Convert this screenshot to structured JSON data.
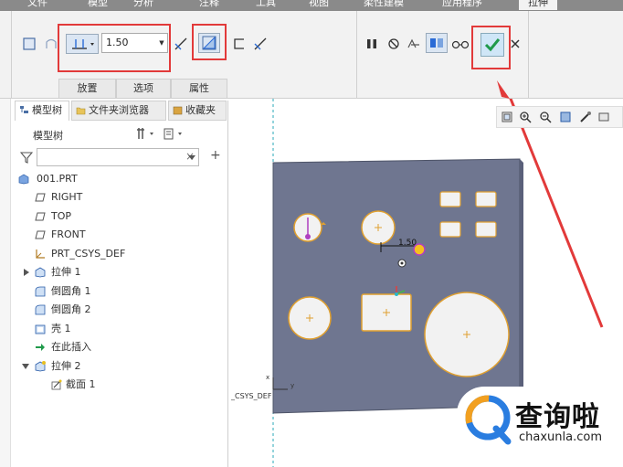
{
  "menu": {
    "tabs": [
      "文件",
      "模型",
      "分析",
      "注释",
      "工具",
      "视图",
      "柔性建模",
      "应用程序",
      "拉伸"
    ],
    "active_tab": "拉伸"
  },
  "ribbon": {
    "depth_value": "1.50",
    "subtabs": [
      "放置",
      "选项",
      "属性"
    ]
  },
  "panel": {
    "tabs": [
      "模型树",
      "文件夹浏览器",
      "收藏夹"
    ],
    "tree_title": "模型树",
    "filter_clear": "×",
    "filter_add": "+",
    "items": [
      {
        "label": "001.PRT",
        "icon": "part-icon"
      },
      {
        "label": "RIGHT",
        "icon": "datum-plane-icon"
      },
      {
        "label": "TOP",
        "icon": "datum-plane-icon"
      },
      {
        "label": "FRONT",
        "icon": "datum-plane-icon"
      },
      {
        "label": "PRT_CSYS_DEF",
        "icon": "csys-icon"
      },
      {
        "label": "拉伸 1",
        "icon": "extrude-icon"
      },
      {
        "label": "倒圆角 1",
        "icon": "round-icon"
      },
      {
        "label": "倒圆角 2",
        "icon": "round-icon"
      },
      {
        "label": "壳 1",
        "icon": "shell-icon"
      },
      {
        "label": "在此插入",
        "icon": "insert-here-icon"
      },
      {
        "label": "拉伸 2",
        "icon": "extrude-icon"
      },
      {
        "label": "截面 1",
        "icon": "sketch-icon"
      }
    ]
  },
  "viewport": {
    "dimension_label": "1.50",
    "csys_label": "_CSYS_DEF",
    "axis_x": "x",
    "axis_y": "y"
  },
  "watermark": {
    "title": "查询啦",
    "url": "chaxunla.com"
  },
  "colors": {
    "plate": "#6f7690",
    "accent_red": "#e23a3a",
    "confirm_green": "#1f9a4a"
  }
}
